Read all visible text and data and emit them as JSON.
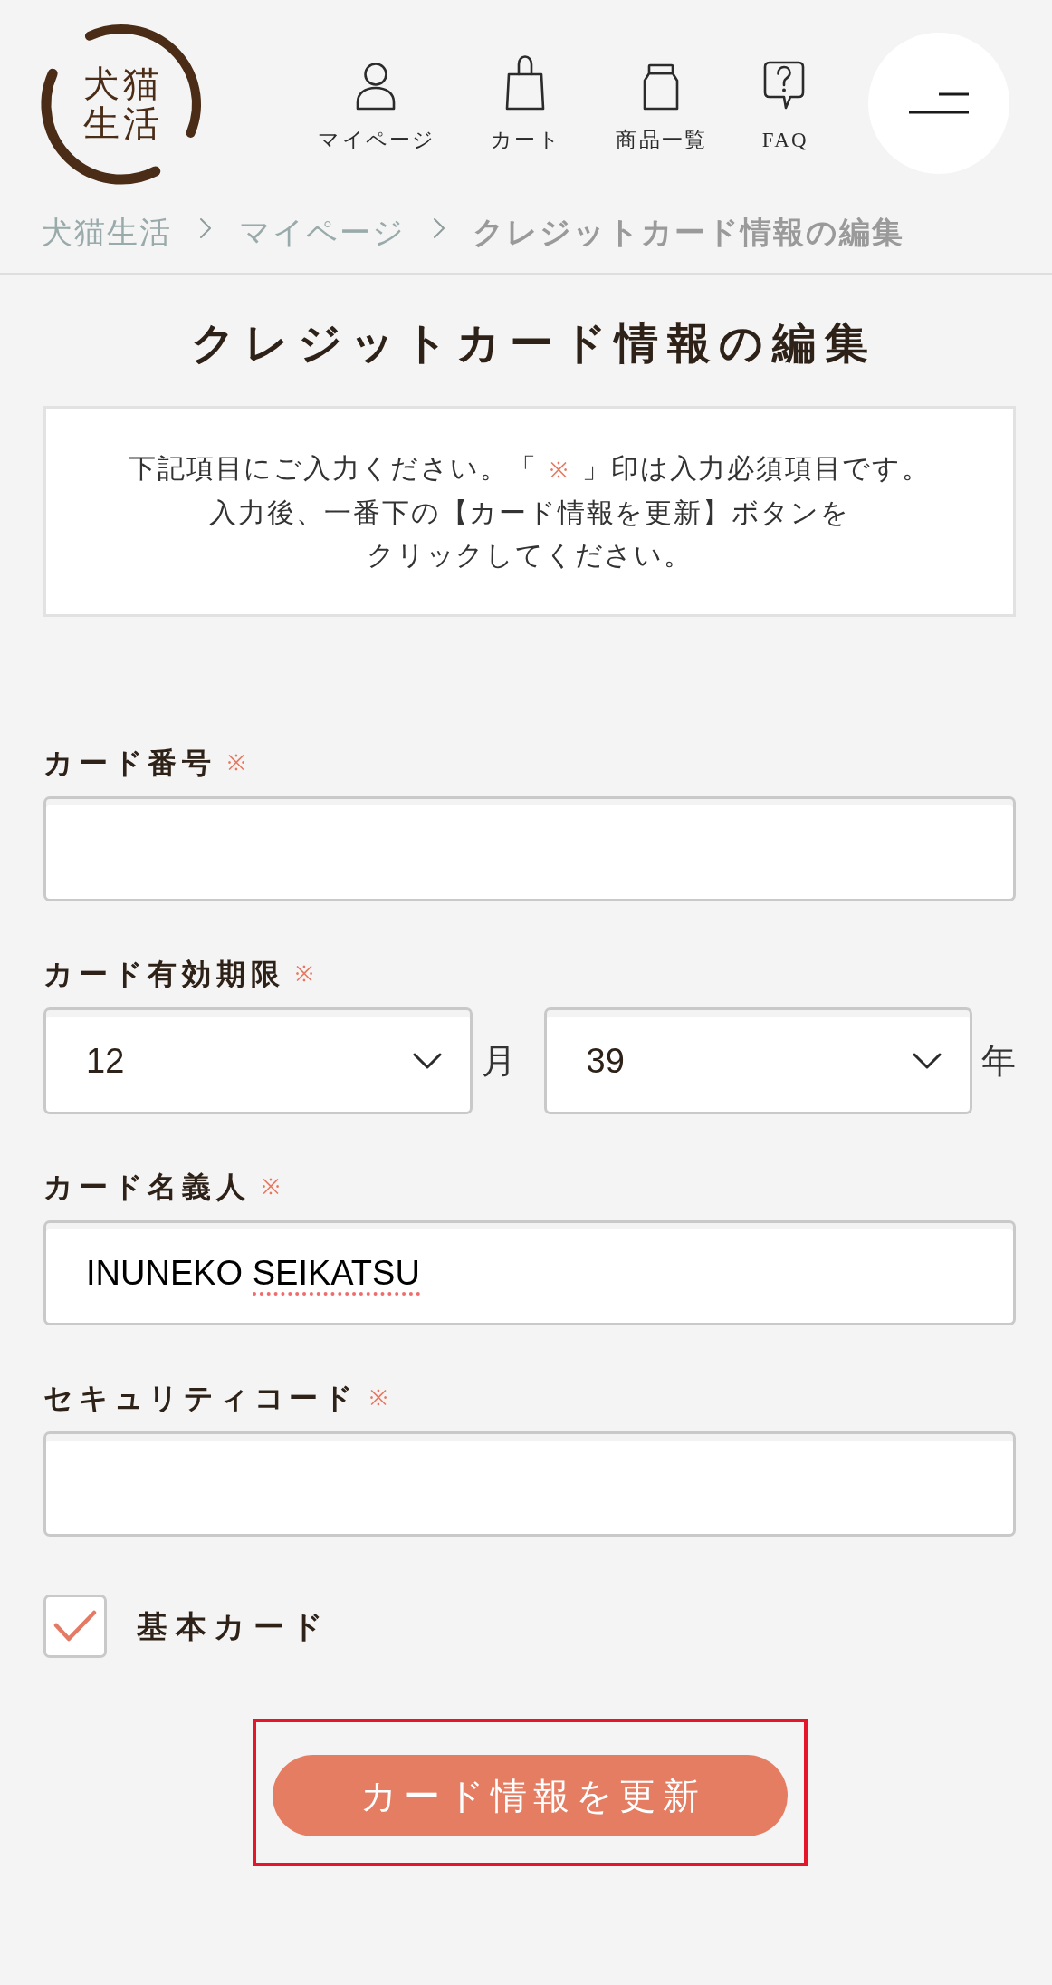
{
  "header": {
    "logo": {
      "lines": [
        "犬猫",
        "生活"
      ]
    },
    "nav": [
      {
        "kind": "account",
        "label": "マイページ"
      },
      {
        "kind": "cart",
        "label": "カート"
      },
      {
        "kind": "catalog",
        "label": "商品一覧"
      },
      {
        "kind": "faq",
        "label": "FAQ"
      }
    ]
  },
  "breadcrumb": [
    {
      "label": "犬猫生活",
      "current": false
    },
    {
      "label": "マイページ",
      "current": false
    },
    {
      "label": "クレジットカード情報の編集",
      "current": true
    }
  ],
  "title": "クレジットカード情報の編集",
  "instructions": {
    "lines": [
      {
        "segments": [
          {
            "kind": "plain",
            "text": "下記項目にご入力ください。「"
          },
          {
            "kind": "mark",
            "text": "※"
          },
          {
            "kind": "plain",
            "text": "」印は入力必須項目です。"
          }
        ]
      },
      {
        "segments": [
          {
            "kind": "plain",
            "text": "入力後、一番下の【カード情報を更新】ボタンを"
          }
        ]
      },
      {
        "segments": [
          {
            "kind": "plain",
            "text": "クリックしてください。"
          }
        ]
      }
    ]
  },
  "form": {
    "fields": [
      {
        "kind": "text",
        "label": "カード番号",
        "required_mark": "※"
      },
      {
        "kind": "selects",
        "label": "カード有効期限",
        "required_mark": "※",
        "selects": [
          {
            "value": "12",
            "unit": "月"
          },
          {
            "value": "39",
            "unit": "年"
          }
        ]
      },
      {
        "kind": "text",
        "label": "カード名義人",
        "required_mark": "※",
        "value_words": [
          {
            "text": "INUNEKO",
            "flagged": false
          },
          {
            "text": "SEIKATSU",
            "flagged": true
          }
        ]
      },
      {
        "kind": "text",
        "label": "セキュリティコード",
        "required_mark": "※"
      }
    ],
    "checkbox": {
      "label": "基本カード",
      "checked": true
    },
    "submit": {
      "label": "カード情報を更新",
      "highlighted": true
    }
  }
}
